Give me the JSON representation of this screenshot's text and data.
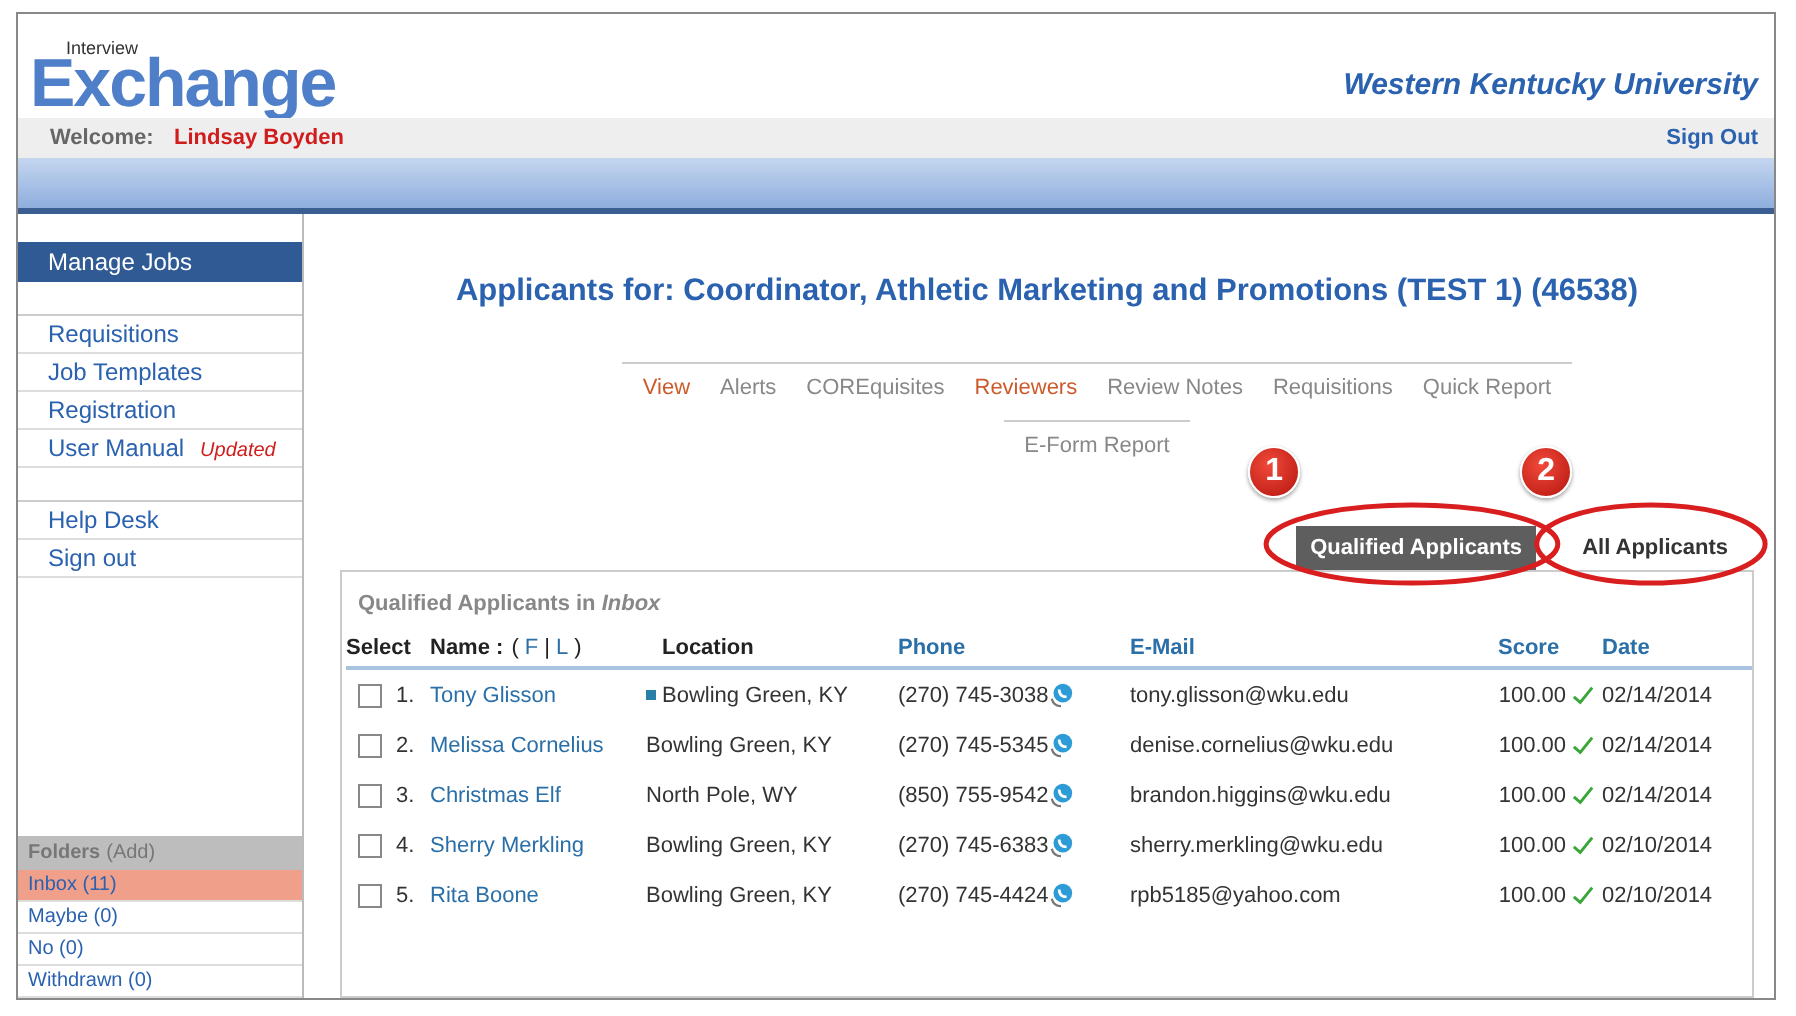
{
  "header": {
    "logo_small": "Interview",
    "logo_main": "Exchange",
    "institution": "Western Kentucky University"
  },
  "welcome": {
    "label": "Welcome:",
    "user": "Lindsay Boyden",
    "sign_out": "Sign Out"
  },
  "sidebar": {
    "groups": [
      [
        {
          "label": "Manage Jobs",
          "selected": true
        }
      ],
      [
        {
          "label": "Requisitions",
          "selected": false
        },
        {
          "label": "Job Templates",
          "selected": false
        },
        {
          "label": "Registration",
          "selected": false
        },
        {
          "label": "User Manual",
          "selected": false,
          "badge": "Updated"
        }
      ],
      [
        {
          "label": "Help Desk",
          "selected": false
        },
        {
          "label": "Sign out",
          "selected": false
        }
      ]
    ],
    "folders": {
      "title": "Folders",
      "add": "(Add)",
      "items": [
        {
          "label": "Inbox (11)",
          "selected": true
        },
        {
          "label": "Maybe (0)",
          "selected": false
        },
        {
          "label": "No (0)",
          "selected": false
        },
        {
          "label": "Withdrawn (0)",
          "selected": false
        }
      ]
    }
  },
  "title": "Applicants for: Coordinator, Athletic Marketing and Promotions (TEST 1) (46538)",
  "subnav": [
    [
      {
        "label": "View",
        "highlighted": true
      },
      {
        "label": "Alerts",
        "highlighted": false
      },
      {
        "label": "COREquisites",
        "highlighted": false
      },
      {
        "label": "Reviewers",
        "highlighted": true
      },
      {
        "label": "Review Notes",
        "highlighted": false
      },
      {
        "label": "Requisitions",
        "highlighted": false
      },
      {
        "label": "Quick Report",
        "highlighted": false
      }
    ],
    [
      {
        "label": "E-Form Report",
        "highlighted": false
      }
    ]
  ],
  "view_tabs": [
    {
      "label": "Qualified Applicants",
      "selected": true,
      "callout": "1"
    },
    {
      "label": "All Applicants",
      "selected": false,
      "callout": "2"
    }
  ],
  "panel_title": "Qualified Applicants in *Inbox*",
  "columns": [
    {
      "label": "Select",
      "kind": "plain"
    },
    {
      "label": "Name :",
      "kind": "name",
      "sort": {
        "open": "(",
        "options": [
          "F",
          "L"
        ],
        "separator": "|",
        "close": ")"
      }
    },
    {
      "label": "Location",
      "kind": "plain"
    },
    {
      "label": "Phone",
      "kind": "link"
    },
    {
      "label": "E-Mail",
      "kind": "link"
    },
    {
      "label": "Score",
      "kind": "link"
    },
    {
      "label": "Date",
      "kind": "link"
    }
  ],
  "rows": [
    {
      "checked": false,
      "number": "1.",
      "name": "Tony Glisson",
      "marked": true,
      "location": "Bowling Green, KY",
      "phone": "(270) 745-3038",
      "email": "tony.glisson@wku.edu",
      "score": "100.00",
      "passed": true,
      "date": "02/14/2014"
    },
    {
      "checked": false,
      "number": "2.",
      "name": "Melissa Cornelius",
      "marked": false,
      "location": "Bowling Green, KY",
      "phone": "(270) 745-5345",
      "email": "denise.cornelius@wku.edu",
      "score": "100.00",
      "passed": true,
      "date": "02/14/2014"
    },
    {
      "checked": false,
      "number": "3.",
      "name": "Christmas Elf",
      "marked": false,
      "location": "North Pole, WY",
      "phone": "(850) 755-9542",
      "email": "brandon.higgins@wku.edu",
      "score": "100.00",
      "passed": true,
      "date": "02/14/2014"
    },
    {
      "checked": false,
      "number": "4.",
      "name": "Sherry Merkling",
      "marked": false,
      "location": "Bowling Green, KY",
      "phone": "(270) 745-6383",
      "email": "sherry.merkling@wku.edu",
      "score": "100.00",
      "passed": true,
      "date": "02/10/2014"
    },
    {
      "checked": false,
      "number": "5.",
      "name": "Rita Boone",
      "marked": false,
      "location": "Bowling Green, KY",
      "phone": "(270) 745-4424",
      "email": "rpb5185@yahoo.com",
      "score": "100.00",
      "passed": true,
      "date": "02/10/2014"
    }
  ]
}
